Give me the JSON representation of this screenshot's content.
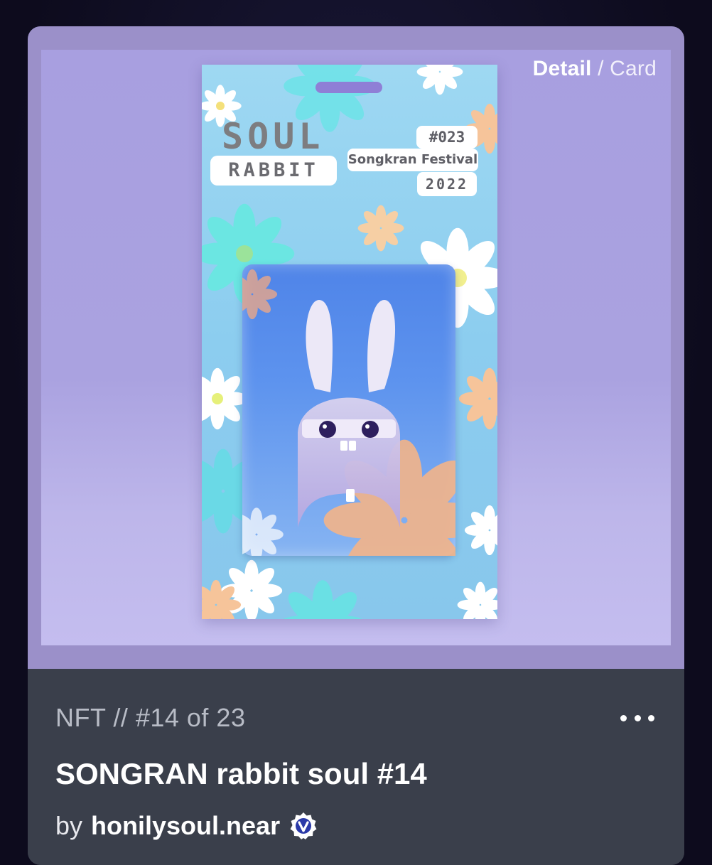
{
  "view_toggle": {
    "active": "Detail",
    "separator": "/",
    "inactive": "Card"
  },
  "artwork": {
    "brand_line1": "SOUL",
    "brand_line2": "RABBIT",
    "number_tag": "#023",
    "festival_tag": "Songkran Festival",
    "year_tag": "2022"
  },
  "nft": {
    "edition": "NFT // #14 of 23",
    "title": "SONGRAN rabbit soul #14",
    "by_label": "by",
    "owner": "honilysoul.near",
    "verified_icon": "verified-badge-icon"
  },
  "colors": {
    "media_bg": "#a89fe0",
    "info_bg": "#3a3f4b",
    "verified_badge": "#2b3aa8"
  }
}
